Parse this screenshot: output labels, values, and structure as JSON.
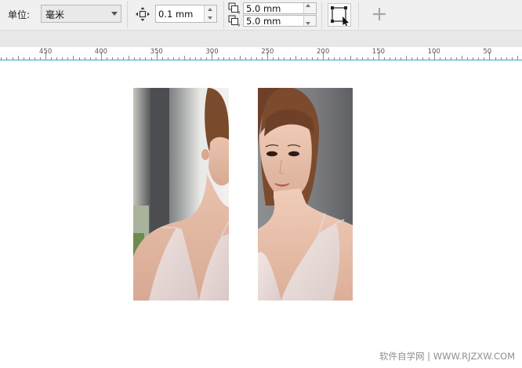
{
  "toolbar": {
    "unit_label": "单位:",
    "unit_value": "毫米",
    "nudge_value": "0.1 mm",
    "duplicate_x": "5.0 mm",
    "duplicate_y": "5.0 mm",
    "add_icon": "plus-icon",
    "nudge_icon": "nudge-arrows-icon",
    "transform_icon": "transform-object-icon"
  },
  "ruler": {
    "labels": [
      "450",
      "400",
      "350",
      "300",
      "250",
      "200",
      "150",
      "100",
      "50"
    ],
    "accent_color": "#3aa0dd"
  },
  "watermark": "软件自学网 | WWW.RJZXW.COM"
}
